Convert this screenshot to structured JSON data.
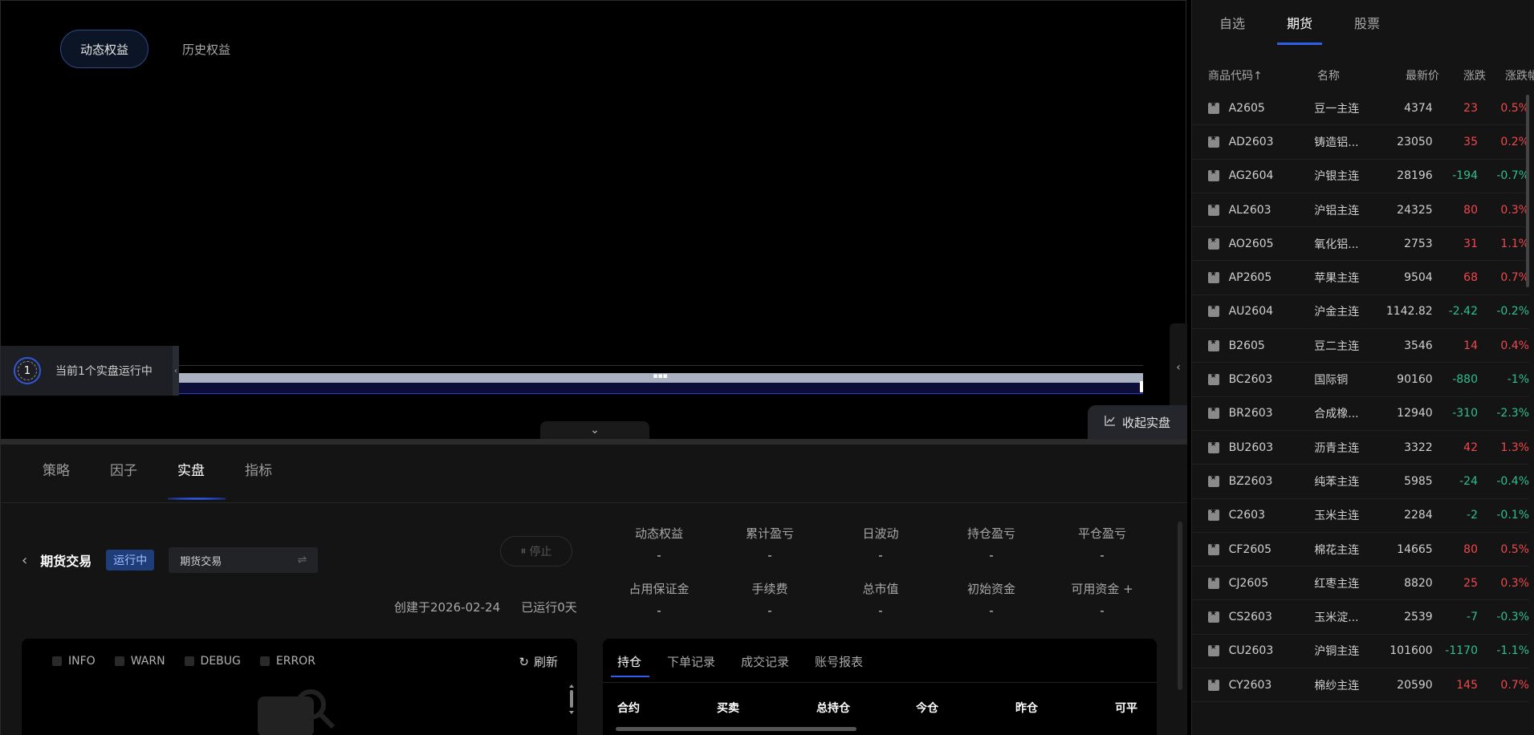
{
  "equity_tabs": [
    "动态权益",
    "历史权益"
  ],
  "running": {
    "count": "1",
    "text": "当前1个实盘运行中"
  },
  "fold_button": "收起实盘",
  "module_tabs": [
    "策略",
    "因子",
    "实盘",
    "指标"
  ],
  "trade": {
    "title": "期货交易",
    "status": "运行中",
    "select_value": "期货交易",
    "stop_label": "停止",
    "created": "创建于2026-02-24",
    "running_days": "已运行0天"
  },
  "metrics": [
    {
      "label": "动态权益",
      "value": "-"
    },
    {
      "label": "累计盈亏",
      "value": "-"
    },
    {
      "label": "日波动",
      "value": "-"
    },
    {
      "label": "持仓盈亏",
      "value": "-"
    },
    {
      "label": "平仓盈亏",
      "value": "-"
    },
    {
      "label": "占用保证金",
      "value": "-"
    },
    {
      "label": "手续费",
      "value": "-"
    },
    {
      "label": "总市值",
      "value": "-"
    },
    {
      "label": "初始资金",
      "value": "-"
    },
    {
      "label": "可用资金 +",
      "value": "-"
    }
  ],
  "log_filters": [
    "INFO",
    "WARN",
    "DEBUG",
    "ERROR"
  ],
  "refresh_label": "刷新",
  "position_tabs": [
    "持仓",
    "下单记录",
    "成交记录",
    "账号报表"
  ],
  "position_columns": [
    "合约",
    "买卖",
    "总持仓",
    "今仓",
    "昨仓",
    "可平"
  ],
  "watch_tabs": [
    "自选",
    "期货",
    "股票"
  ],
  "watch_columns": [
    "商品代码↑",
    "名称",
    "最新价",
    "涨跌",
    "涨跌幅"
  ],
  "watch_rows": [
    {
      "code": "A2605",
      "name": "豆一主连",
      "price": "4374",
      "chg": "23",
      "pct": "0.5%",
      "dir": "up"
    },
    {
      "code": "AD2603",
      "name": "铸造铝...",
      "price": "23050",
      "chg": "35",
      "pct": "0.2%",
      "dir": "up"
    },
    {
      "code": "AG2604",
      "name": "沪银主连",
      "price": "28196",
      "chg": "-194",
      "pct": "-0.7%",
      "dir": "down"
    },
    {
      "code": "AL2603",
      "name": "沪铝主连",
      "price": "24325",
      "chg": "80",
      "pct": "0.3%",
      "dir": "up"
    },
    {
      "code": "AO2605",
      "name": "氧化铝...",
      "price": "2753",
      "chg": "31",
      "pct": "1.1%",
      "dir": "up"
    },
    {
      "code": "AP2605",
      "name": "苹果主连",
      "price": "9504",
      "chg": "68",
      "pct": "0.7%",
      "dir": "up"
    },
    {
      "code": "AU2604",
      "name": "沪金主连",
      "price": "1142.82",
      "chg": "-2.42",
      "pct": "-0.2%",
      "dir": "down"
    },
    {
      "code": "B2605",
      "name": "豆二主连",
      "price": "3546",
      "chg": "14",
      "pct": "0.4%",
      "dir": "up"
    },
    {
      "code": "BC2603",
      "name": "国际铜",
      "price": "90160",
      "chg": "-880",
      "pct": "-1%",
      "dir": "down"
    },
    {
      "code": "BR2603",
      "name": "合成橡...",
      "price": "12940",
      "chg": "-310",
      "pct": "-2.3%",
      "dir": "down"
    },
    {
      "code": "BU2603",
      "name": "沥青主连",
      "price": "3322",
      "chg": "42",
      "pct": "1.3%",
      "dir": "up"
    },
    {
      "code": "BZ2603",
      "name": "纯苯主连",
      "price": "5985",
      "chg": "-24",
      "pct": "-0.4%",
      "dir": "down"
    },
    {
      "code": "C2603",
      "name": "玉米主连",
      "price": "2284",
      "chg": "-2",
      "pct": "-0.1%",
      "dir": "down"
    },
    {
      "code": "CF2605",
      "name": "棉花主连",
      "price": "14665",
      "chg": "80",
      "pct": "0.5%",
      "dir": "up"
    },
    {
      "code": "CJ2605",
      "name": "红枣主连",
      "price": "8820",
      "chg": "25",
      "pct": "0.3%",
      "dir": "up"
    },
    {
      "code": "CS2603",
      "name": "玉米淀...",
      "price": "2539",
      "chg": "-7",
      "pct": "-0.3%",
      "dir": "down"
    },
    {
      "code": "CU2603",
      "name": "沪铜主连",
      "price": "101600",
      "chg": "-1170",
      "pct": "-1.1%",
      "dir": "down"
    },
    {
      "code": "CY2603",
      "name": "棉纱主连",
      "price": "20590",
      "chg": "145",
      "pct": "0.7%",
      "dir": "up"
    }
  ],
  "colors": {
    "up": "#f0484d",
    "down": "#2fbf8e",
    "accent": "#2f5fe8"
  }
}
